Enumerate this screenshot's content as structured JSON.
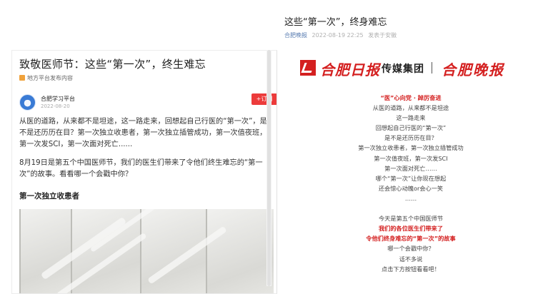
{
  "right_header": {
    "title": "这些“第一次”，终身难忘",
    "source": "合肥晚报",
    "datetime": "2022-08-19 22:25",
    "location": "发表于安徽"
  },
  "article": {
    "title": "致敬医师节：这些“第一次”，终生难忘",
    "platform_label": "地方平台发布内容",
    "author": "合肥学习平台",
    "date": "2022-08-20",
    "subscribe_label": "+订阅",
    "paragraph1": "从医的道路，从来都不是坦途，这一路走来，回想起自己行医的“第一次”，是不是还历历在目？第一次独立收患者，第一次独立插管成功，第一次值夜班，第一次发SCI，第一次面对死亡......",
    "paragraph2": "8月19日是第五个中国医师节，我们的医生们带来了令他们终生难忘的“第一次”的故事。看看哪一个会戳中你？",
    "section_heading": "第一次独立收患者"
  },
  "poster": {
    "logo_paper": "合肥日报",
    "logo_group": "传媒集团",
    "logo_evening": "合肥晚报",
    "lines": [
      {
        "text": "“医”心向党 · 踔厉奋进",
        "red": true
      },
      {
        "text": "从医的道路，从来都不是坦途",
        "red": false
      },
      {
        "text": "这一路走来",
        "red": false
      },
      {
        "text": "回想起自己行医的“第一次”",
        "red": false
      },
      {
        "text": "是不是还历历在目？",
        "red": false
      },
      {
        "text": "第一次独立收患者，第一次独立插管成功",
        "red": false
      },
      {
        "text": "第一次值夜班，第一次发SCI",
        "red": false
      },
      {
        "text": "第一次面对死亡……",
        "red": false
      },
      {
        "text": "哪个“第一次”让你现在想起",
        "red": false
      },
      {
        "text": "还会惊心动魄or会心一笑",
        "red": false
      },
      {
        "text": "……",
        "red": false
      },
      {
        "text": "",
        "red": false
      },
      {
        "text": "今天是第五个中国医师节",
        "red": false
      },
      {
        "text": "我们的各位医生们带来了",
        "red": true
      },
      {
        "text": "令他们终身难忘的“第一次”的故事",
        "red": true
      },
      {
        "text": "哪一个会戳中你？",
        "red": false
      },
      {
        "text": "话不多说",
        "red": false
      },
      {
        "text": "点击下方按钮看看吧！",
        "red": false
      }
    ]
  },
  "colors": {
    "accent_red": "#d42020",
    "subscribe_red": "#ec3b3b",
    "meta_gray": "#b0b0b0"
  },
  "icons": {
    "platform_icon": "document-icon",
    "avatar": "organization-avatar",
    "logo": "newspaper-logo-icon"
  }
}
